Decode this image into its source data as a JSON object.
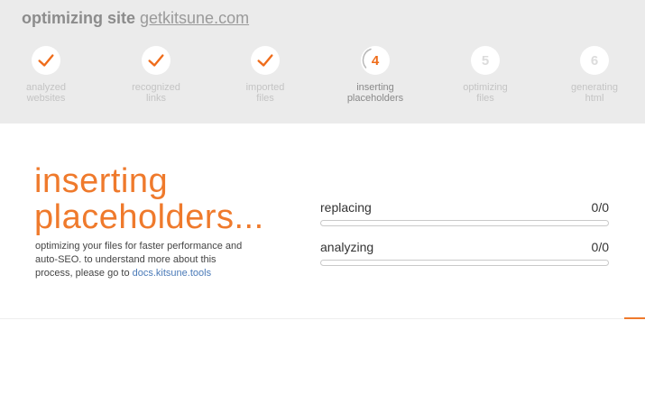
{
  "header": {
    "prefix": "optimizing site",
    "domain": "getkitsune.com"
  },
  "steps": [
    {
      "label_line1": "analyzed",
      "label_line2": "websites",
      "state": "done",
      "icon": "check-icon"
    },
    {
      "label_line1": "recognized",
      "label_line2": "links",
      "state": "done",
      "icon": "check-icon"
    },
    {
      "label_line1": "imported",
      "label_line2": "files",
      "state": "done",
      "icon": "check-icon"
    },
    {
      "number": "4",
      "label_line1": "inserting",
      "label_line2": "placeholders",
      "state": "active"
    },
    {
      "number": "5",
      "label_line1": "optimizing",
      "label_line2": "files",
      "state": "pending"
    },
    {
      "number": "6",
      "label_line1": "generating",
      "label_line2": "html",
      "state": "pending"
    }
  ],
  "main": {
    "title_line1": "inserting",
    "title_line2": "placeholders...",
    "description": "optimizing your files for faster performance and auto-SEO. to understand more about this process, please go to",
    "docs_link": "docs.kitsune.tools"
  },
  "progress": [
    {
      "label": "replacing",
      "count": "0/0",
      "fraction": 0
    },
    {
      "label": "analyzing",
      "count": "0/0",
      "fraction": 0
    }
  ],
  "colors": {
    "accent": "#ef6c1a",
    "header_bg": "#ebebeb",
    "link": "#4a7ab8"
  }
}
